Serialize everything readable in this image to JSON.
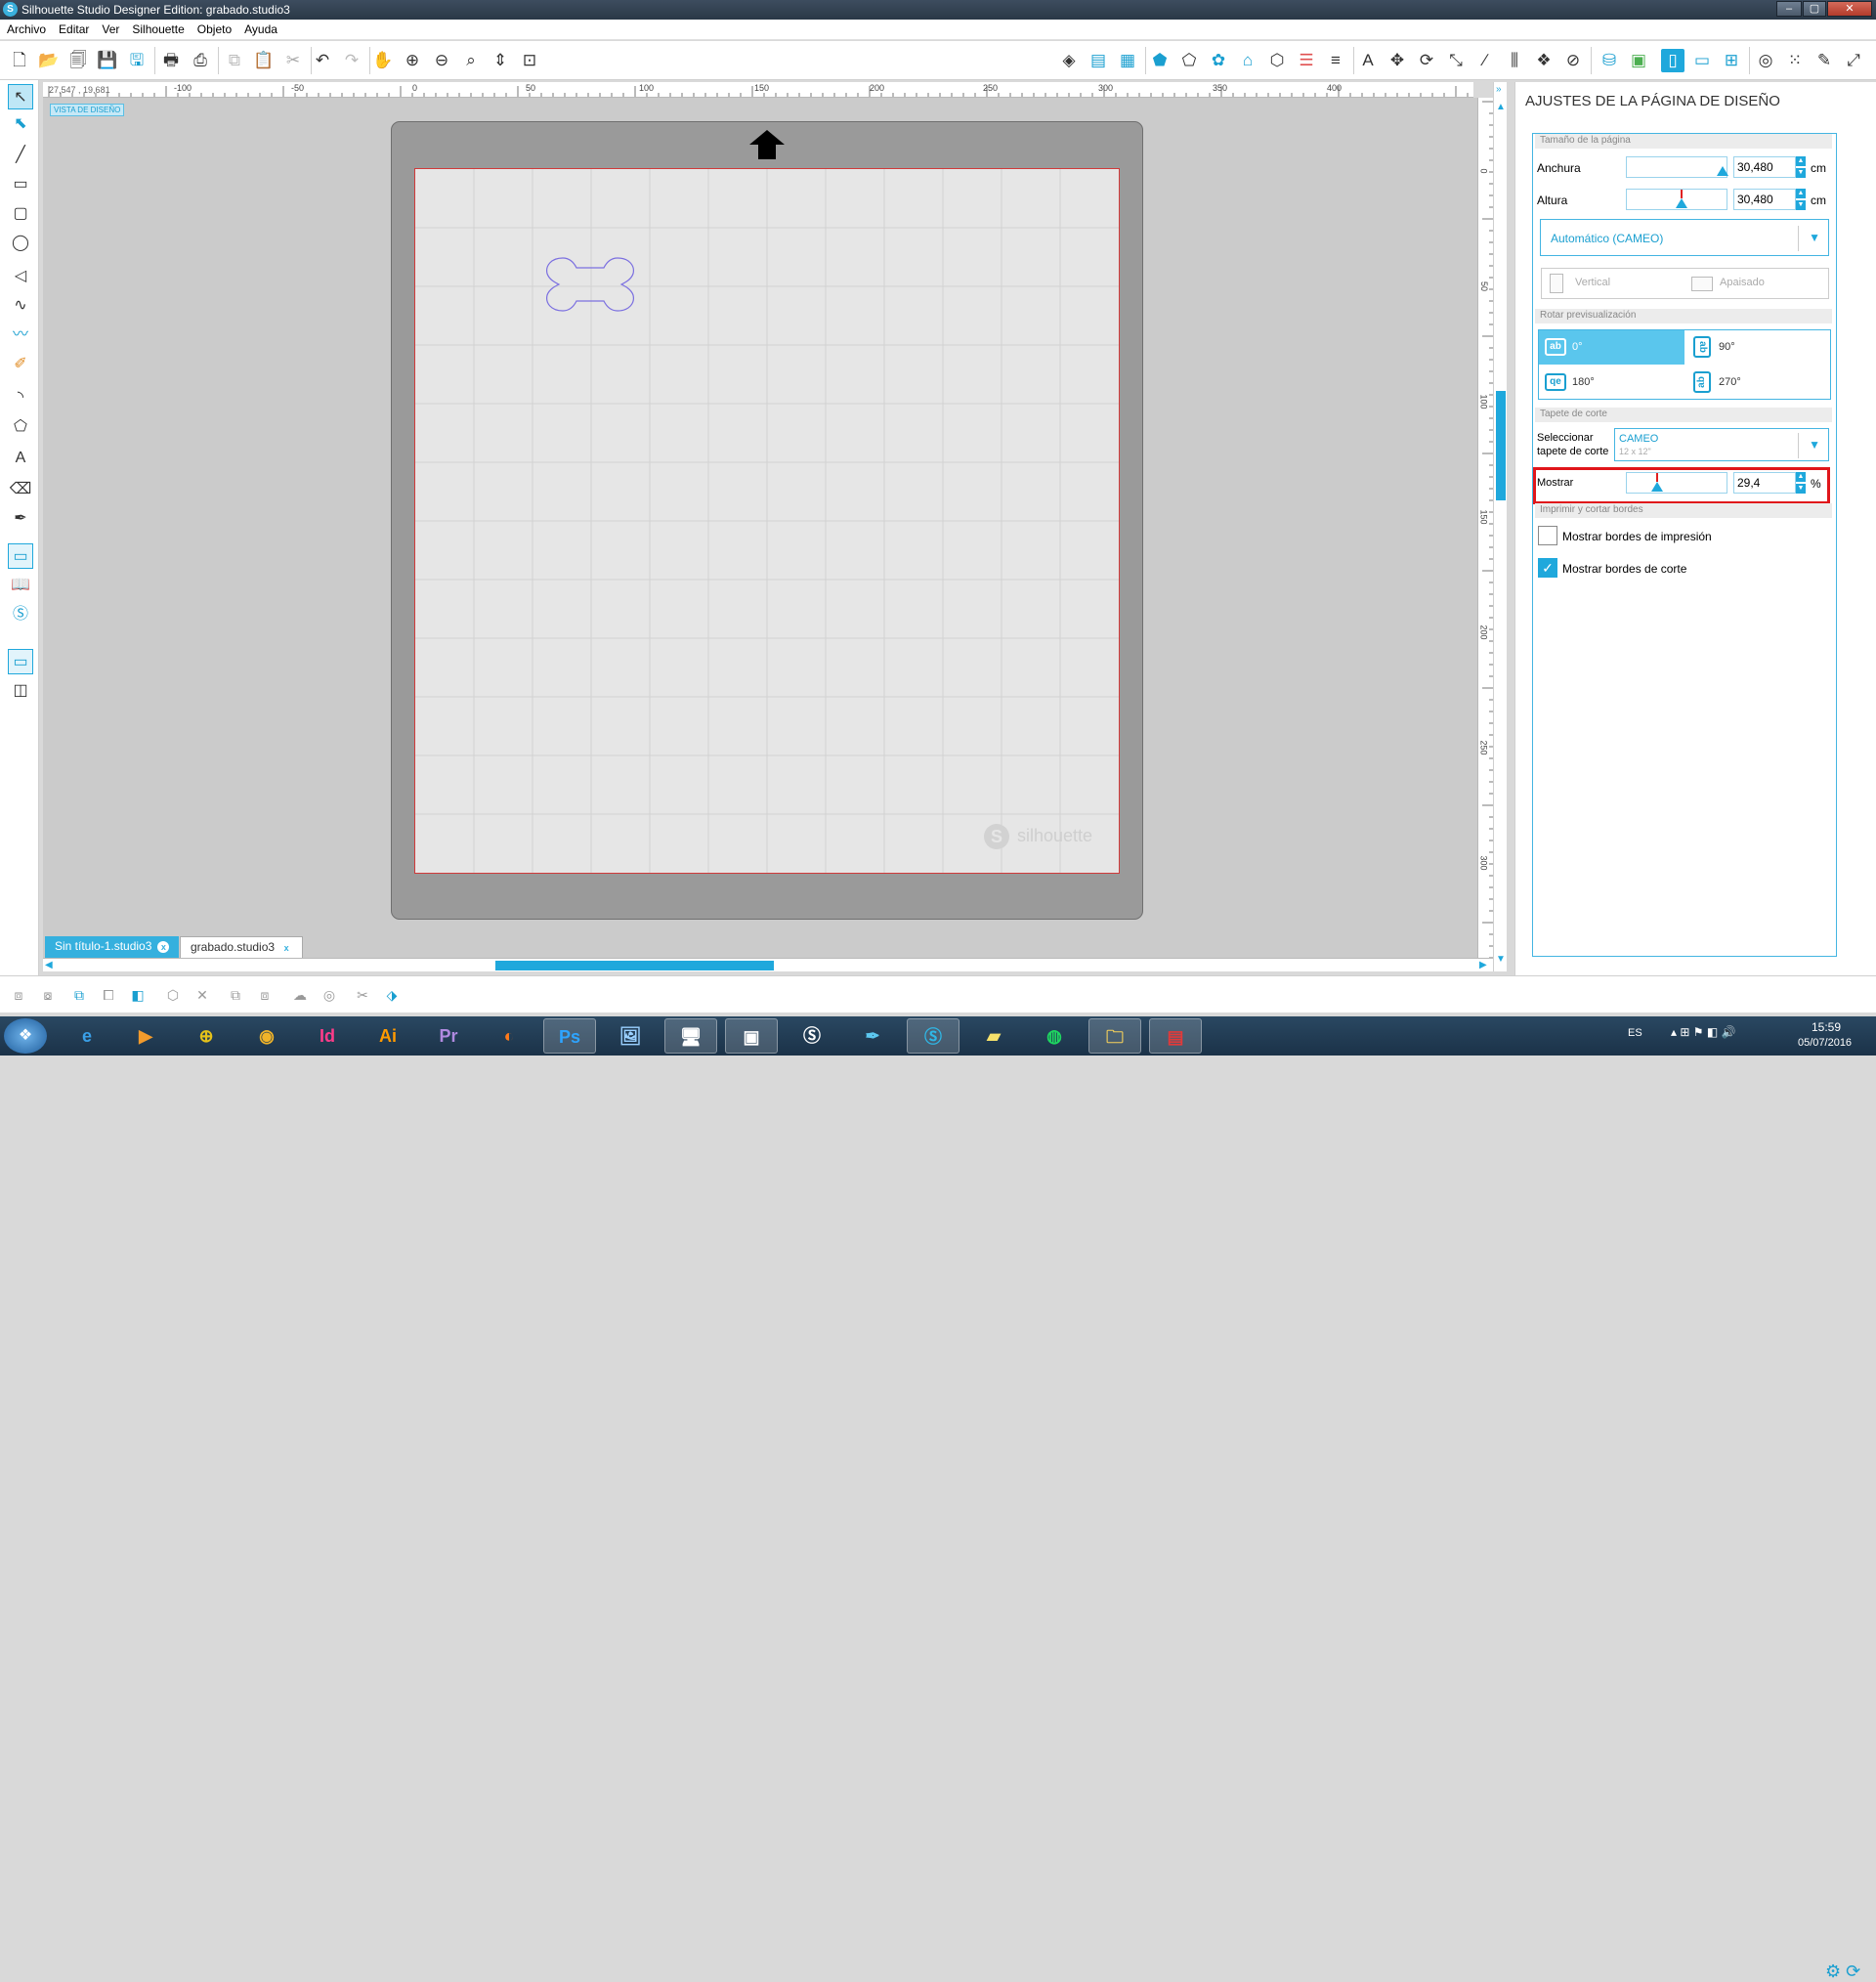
{
  "titlebar": {
    "title": "Silhouette Studio Designer Edition: grabado.studio3",
    "min": "–",
    "max": "▢",
    "close": "✕"
  },
  "menu": [
    "Archivo",
    "Editar",
    "Ver",
    "Silhouette",
    "Objeto",
    "Ayuda"
  ],
  "toolbar_icons": {
    "left": [
      "new-document-icon",
      "open-icon",
      "open-library-icon",
      "save-icon",
      "save-to-library-icon",
      "print-icon",
      "send-to-silhouette-icon",
      "copy-icon",
      "paste-icon",
      "cut-icon",
      "undo-icon",
      "redo-icon",
      "pan-icon",
      "zoom-in-icon",
      "zoom-out-icon",
      "zoom-select-icon",
      "zoom-drag-icon",
      "fit-to-page-icon"
    ],
    "right": [
      "fill-color-icon",
      "fill-gradient-icon",
      "fill-pattern-icon",
      "line-color-icon",
      "line-style-icon",
      "shape-fill-icon",
      "offset-icon",
      "trace-icon",
      "line-panel-icon",
      "line-width-icon",
      "text-icon",
      "transform-icon",
      "rotate-icon",
      "scale-icon",
      "knife-icon",
      "align-icon",
      "replicate-icon",
      "modify-icon",
      "design-store-icon",
      "library-icon",
      "page-setup-icon",
      "cut-settings-icon",
      "registration-icon",
      "grid-icon",
      "offset-panel-icon",
      "pixscan-icon",
      "sketch-icon",
      "send-icon"
    ]
  },
  "coords": {
    "x": "27,547",
    "y": "19,681"
  },
  "view_tag": "VISTA DE DISEÑO",
  "hruler_labels": [
    "-100",
    "-50",
    "0",
    "50",
    "100",
    "150",
    "200",
    "250",
    "300",
    "350",
    "400"
  ],
  "vruler_labels": [
    "0",
    "50",
    "100",
    "150",
    "200",
    "250",
    "300"
  ],
  "watermark": "silhouette",
  "watermark_mark": "S",
  "doc_tabs": [
    {
      "name": "Sin título-1.studio3",
      "close": "x"
    },
    {
      "name": "grabado.studio3",
      "close": "x"
    }
  ],
  "panel": {
    "title": "AJUSTES DE LA PÁGINA DE DISEÑO",
    "page_size": {
      "header": "Tamaño de la página",
      "width_label": "Anchura",
      "width_value": "30,480",
      "height_label": "Altura",
      "height_value": "30,480",
      "unit": "cm",
      "preset": "Automático (CAMEO)",
      "vertical": "Vertical",
      "landscape": "Apaisado"
    },
    "rotate": {
      "header": "Rotar previsualización",
      "options": [
        {
          "label": "0°",
          "icon": "ab"
        },
        {
          "label": "90°",
          "icon": "ab"
        },
        {
          "label": "180°",
          "icon": "qe"
        },
        {
          "label": "270°",
          "icon": "ab"
        }
      ]
    },
    "mat": {
      "header": "Tapete de corte",
      "select_label_1": "Seleccionar",
      "select_label_2": "tapete de corte",
      "select_value": "CAMEO",
      "select_sub": "12 x 12\"",
      "show_label": "Mostrar",
      "show_value": "29,4",
      "show_unit": "%"
    },
    "borders": {
      "header": "Imprimir y cortar bordes",
      "print_borders": "Mostrar bordes de impresión",
      "print_checked": false,
      "cut_borders": "Mostrar bordes de corte",
      "cut_checked": true
    }
  },
  "taskbar": {
    "apps": [
      "windows-start-icon",
      "internet-explorer-icon",
      "media-player-icon",
      "uniformance-icon",
      "chrome-icon",
      "indesign-icon",
      "illustrator-icon",
      "premiere-icon",
      "firefox-icon",
      "photoshop-icon",
      "windows-photo-icon",
      "remote-desktop-icon",
      "photo-viewer-icon",
      "silhouette-icon",
      "feather-icon",
      "silhouette-studio-icon",
      "sticky-notes-icon",
      "spotify-icon",
      "file-explorer-icon",
      "pdf-icon"
    ],
    "labels": {
      "id": "Id",
      "ai": "Ai",
      "pr": "Pr",
      "ps": "Ps"
    },
    "lang": "ES",
    "time": "15:59",
    "date": "05/07/2016"
  },
  "colors": {
    "accent": "#1fa8dc",
    "highlight": "#e0161b",
    "cut_line": "#d03a3a",
    "bone": "#7b6fe0"
  }
}
